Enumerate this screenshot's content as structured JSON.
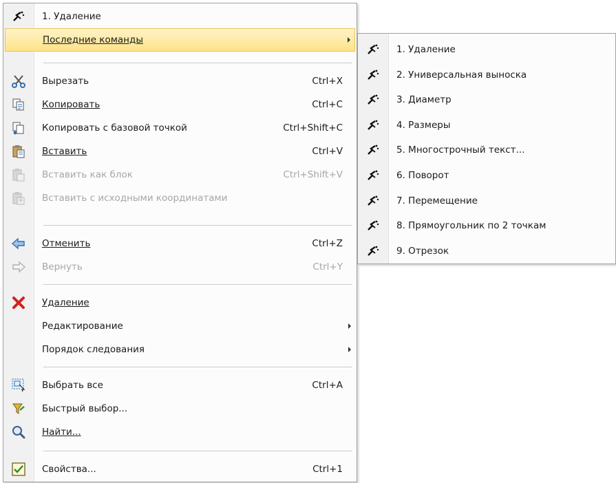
{
  "main_menu": {
    "items": [
      {
        "id": "recent-1",
        "label": "1. Удаление",
        "shortcut": "",
        "icon": "command-icon",
        "disabled": false
      },
      {
        "id": "recent-commands",
        "label": "Последние команды",
        "shortcut": "",
        "icon": "",
        "disabled": false,
        "submenu": true,
        "highlighted": true
      },
      {
        "id": "cut",
        "label": "Вырезать",
        "shortcut": "Ctrl+X",
        "icon": "scissors-icon",
        "disabled": false
      },
      {
        "id": "copy",
        "label": "Копировать",
        "shortcut": "Ctrl+C",
        "icon": "copy-icon",
        "disabled": false
      },
      {
        "id": "copy-base",
        "label": "Копировать с базовой точкой",
        "shortcut": "Ctrl+Shift+C",
        "icon": "copy-base-icon",
        "disabled": false
      },
      {
        "id": "paste",
        "label": "Вставить",
        "shortcut": "Ctrl+V",
        "icon": "paste-icon",
        "disabled": false
      },
      {
        "id": "paste-block",
        "label": "Вставить как блок",
        "shortcut": "Ctrl+Shift+V",
        "icon": "paste-block-icon",
        "disabled": true
      },
      {
        "id": "paste-orig",
        "label": "Вставить с исходными координатами",
        "shortcut": "",
        "icon": "paste-original-icon",
        "disabled": true
      },
      {
        "id": "undo",
        "label": "Отменить",
        "shortcut": "Ctrl+Z",
        "icon": "undo-icon",
        "disabled": false
      },
      {
        "id": "redo",
        "label": "Вернуть",
        "shortcut": "Ctrl+Y",
        "icon": "redo-icon",
        "disabled": true
      },
      {
        "id": "erase",
        "label": "Удаление",
        "shortcut": "",
        "icon": "delete-icon",
        "disabled": false
      },
      {
        "id": "edit",
        "label": "Редактирование",
        "shortcut": "",
        "icon": "",
        "disabled": false,
        "submenu": true
      },
      {
        "id": "draw-order",
        "label": "Порядок следования",
        "shortcut": "",
        "icon": "",
        "disabled": false,
        "submenu": true
      },
      {
        "id": "select-all",
        "label": "Выбрать все",
        "shortcut": "Ctrl+A",
        "icon": "select-all-icon",
        "disabled": false
      },
      {
        "id": "quick-select",
        "label": "Быстрый выбор...",
        "shortcut": "",
        "icon": "quick-select-icon",
        "disabled": false
      },
      {
        "id": "find",
        "label": "Найти...",
        "shortcut": "",
        "icon": "find-icon",
        "disabled": false
      },
      {
        "id": "properties",
        "label": "Свойства...",
        "shortcut": "Ctrl+1",
        "icon": "properties-icon",
        "disabled": false
      }
    ]
  },
  "sub_menu": {
    "items": [
      {
        "label": "1. Удаление"
      },
      {
        "label": "2. Универсальная выноска"
      },
      {
        "label": "3. Диаметр"
      },
      {
        "label": "4. Размеры"
      },
      {
        "label": "5. Многострочный текст..."
      },
      {
        "label": "6. Поворот"
      },
      {
        "label": "7. Перемещение"
      },
      {
        "label": "8. Прямоугольник по 2 точкам"
      },
      {
        "label": "9. Отрезок"
      }
    ]
  },
  "colors": {
    "highlight": "#fde38a",
    "delete_red": "#d81e1e",
    "icon_blue": "#2f6fb5"
  }
}
